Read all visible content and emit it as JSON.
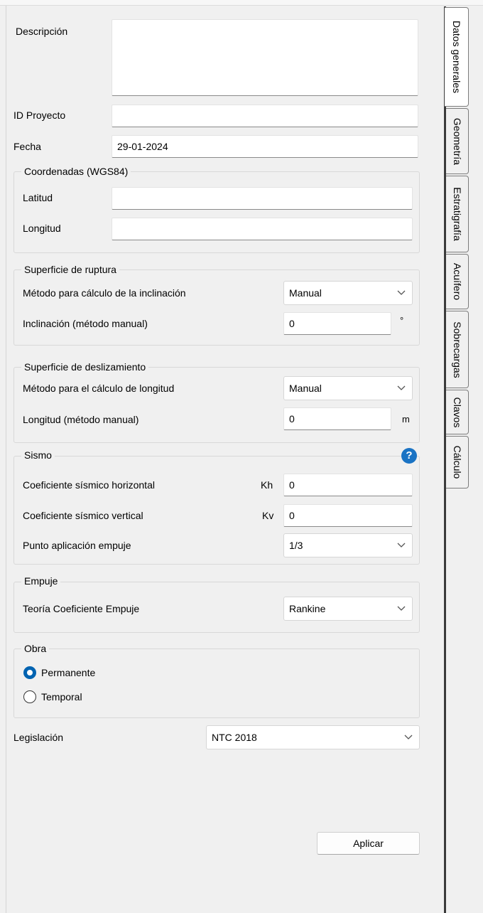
{
  "general": {
    "descripcion_label": "Descripción",
    "descripcion_value": "",
    "id_proyecto_label": "ID Proyecto",
    "id_proyecto_value": "",
    "fecha_label": "Fecha",
    "fecha_value": "29-01-2024"
  },
  "coordenadas": {
    "title": "Coordenadas (WGS84)",
    "latitud_label": "Latitud",
    "latitud_value": "",
    "longitud_label": "Longitud",
    "longitud_value": ""
  },
  "ruptura": {
    "title": "Superficie de ruptura",
    "metodo_label": "Método para cálculo de la inclinación",
    "metodo_value": "Manual",
    "inclinacion_label": "Inclinación (método manual)",
    "inclinacion_value": "0",
    "inclinacion_unit": "°"
  },
  "deslizamiento": {
    "title": "Superficie de deslizamiento",
    "metodo_label": "Método para el cálculo de longitud",
    "metodo_value": "Manual",
    "longitud_label": "Longitud (método manual)",
    "longitud_value": "0",
    "longitud_unit": "m"
  },
  "sismo": {
    "title": "Sismo",
    "help_icon": "?",
    "kh_label": "Coeficiente sísmico horizontal",
    "kh_symbol": "Kh",
    "kh_value": "0",
    "kv_label": "Coeficiente sísmico vertical",
    "kv_symbol": "Kv",
    "kv_value": "0",
    "punto_label": "Punto aplicación empuje",
    "punto_value": "1/3"
  },
  "empuje": {
    "title": "Empuje",
    "teoria_label": "Teoría Coeficiente Empuje",
    "teoria_value": "Rankine"
  },
  "obra": {
    "title": "Obra",
    "options": [
      {
        "label": "Permanente",
        "selected": true
      },
      {
        "label": "Temporal",
        "selected": false
      }
    ]
  },
  "legislacion": {
    "label": "Legislación",
    "value": "NTC 2018"
  },
  "apply_label": "Aplicar",
  "tabs": [
    {
      "label": "Datos generales",
      "active": true
    },
    {
      "label": "Geometría",
      "active": false
    },
    {
      "label": "Estratigrafía",
      "active": false
    },
    {
      "label": "Acuífero",
      "active": false
    },
    {
      "label": "Sobrecargas",
      "active": false
    },
    {
      "label": "Clavos",
      "active": false
    },
    {
      "label": "Cálculo",
      "active": false
    }
  ],
  "colors": {
    "radio_accent": "#0063b1",
    "help_icon": "#1a73c4",
    "panel_bg": "#f0f0f0"
  }
}
